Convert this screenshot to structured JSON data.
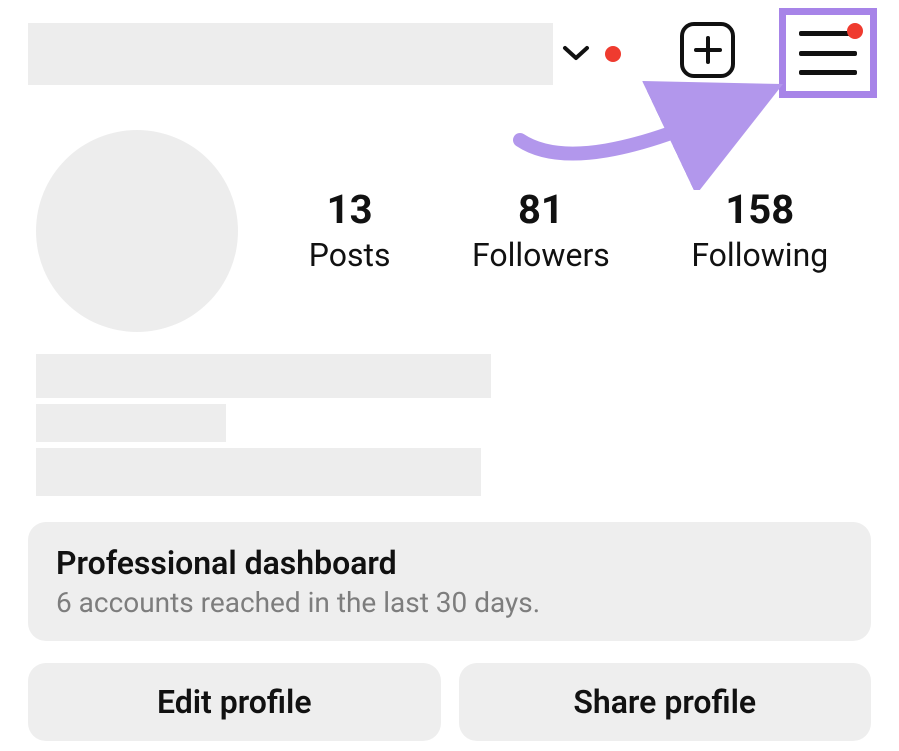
{
  "header": {
    "notification_dot_color": "#ef3b2f",
    "highlight_color": "#a784e8"
  },
  "stats": {
    "posts": {
      "count": "13",
      "label": "Posts"
    },
    "followers": {
      "count": "81",
      "label": "Followers"
    },
    "following": {
      "count": "158",
      "label": "Following"
    }
  },
  "dashboard": {
    "title": "Professional dashboard",
    "subtitle": "6 accounts reached in the last 30 days."
  },
  "actions": {
    "edit": "Edit profile",
    "share": "Share profile"
  }
}
